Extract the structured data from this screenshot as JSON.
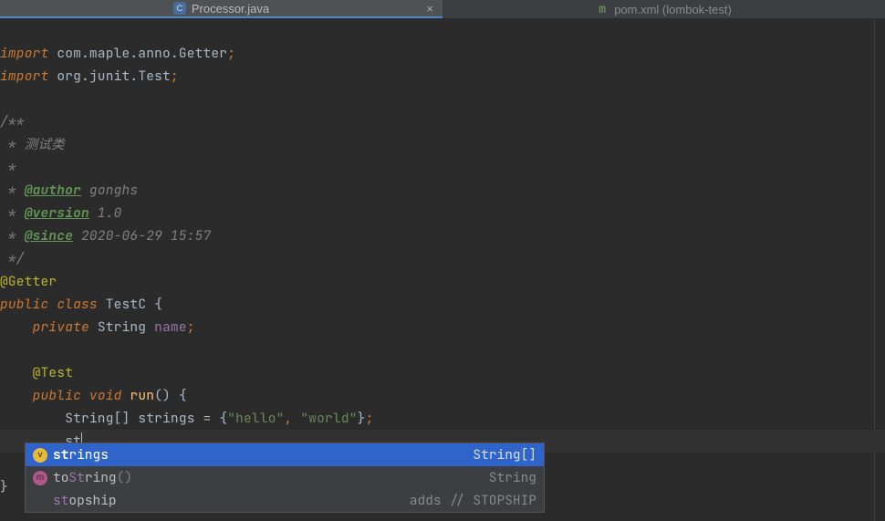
{
  "tabs": {
    "active": {
      "name": "Processor.java",
      "icon": "C"
    },
    "inactive": {
      "name": "pom.xml (lombok-test)",
      "icon": "m"
    }
  },
  "code": {
    "l1_import": "import",
    "l1_pkg": "com.maple.anno.",
    "l1_cls": "Getter",
    "l2_import": "import",
    "l2_pkg": "org.junit.",
    "l2_cls": "Test",
    "doc_open": "/**",
    "doc_star": " * ",
    "doc_desc": " * 测试类",
    "doc_blank": " *",
    "doc_author_tag": "@author",
    "doc_author_val": " gonghs",
    "doc_version_tag": "@version",
    "doc_version_val": " 1.0",
    "doc_since_tag": "@since",
    "doc_since_val": " 2020-06-29 15:57",
    "doc_close": " */",
    "anno_getter": "@Getter",
    "cls_public": "public ",
    "cls_class": "class ",
    "cls_name": "TestC",
    "cls_open": " {",
    "fld_private": "private ",
    "fld_type": "String",
    "fld_name": " name",
    "anno_test": "@Test",
    "m_public": "public ",
    "m_void": "void ",
    "m_name": "run",
    "m_paren": "()",
    "m_open": " {",
    "arr_type": "String",
    "arr_brack": "[]",
    "arr_var": " strings",
    "arr_eq": " = ",
    "arr_open": "{",
    "arr_s1": "\"hello\"",
    "arr_c": ", ",
    "arr_s2": "\"world\"",
    "arr_close": "}",
    "typed": "st",
    "close_brace": "}"
  },
  "completion": {
    "items": [
      {
        "icon": "v",
        "pre": "st",
        "post": "rings",
        "right": "String[]"
      },
      {
        "icon": "m",
        "pre": "to",
        "mid": "St",
        "post": "ring",
        "suffix": "()",
        "right": "String"
      },
      {
        "icon": "",
        "pre": "st",
        "post": "opship",
        "right": "adds // STOPSHIP"
      }
    ]
  }
}
